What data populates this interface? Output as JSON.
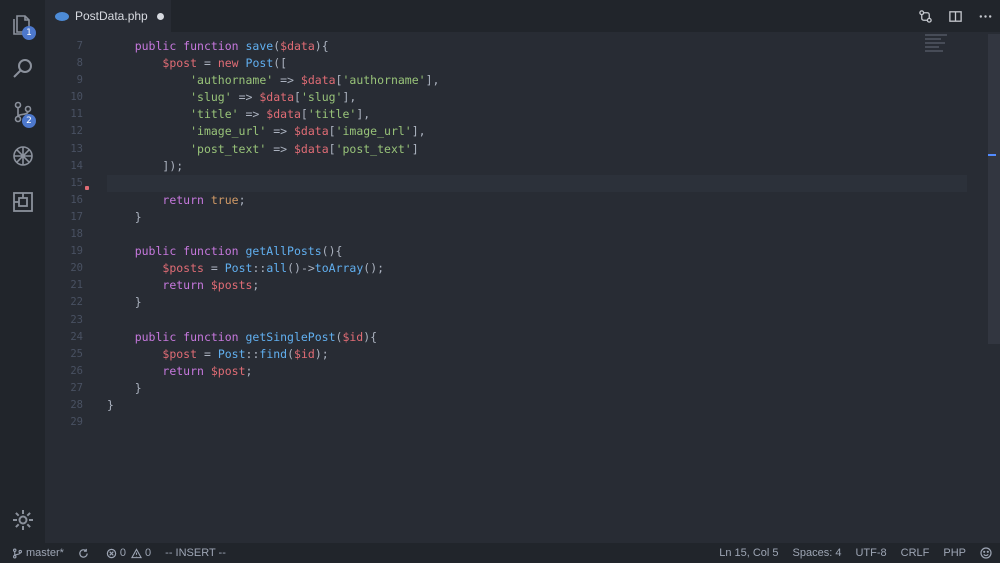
{
  "activity_bar": {
    "explorer_badge": "1",
    "scm_badge": "2"
  },
  "tab": {
    "file_name": "PostData.php",
    "icon": "php-file-icon",
    "dirty_indicator": "dirty-dot"
  },
  "editor": {
    "line_numbers": [
      "7",
      "8",
      "9",
      "10",
      "11",
      "12",
      "13",
      "14",
      "15",
      "16",
      "17",
      "18",
      "19",
      "20",
      "21",
      "22",
      "23",
      "24",
      "25",
      "26",
      "27",
      "28",
      "29"
    ],
    "current_line": "15"
  },
  "status_bar": {
    "branch": "master*",
    "errors": "0",
    "warnings": "0",
    "mode": "-- INSERT --",
    "cursor": "Ln 15, Col 5",
    "spaces": "Spaces: 4",
    "encoding": "UTF-8",
    "eol": "CRLF",
    "language": "PHP"
  },
  "colors": {
    "keyword": "#c678dd",
    "function": "#61afef",
    "variable": "#e06c75",
    "string": "#98c379",
    "accent": "#4d78cc"
  }
}
